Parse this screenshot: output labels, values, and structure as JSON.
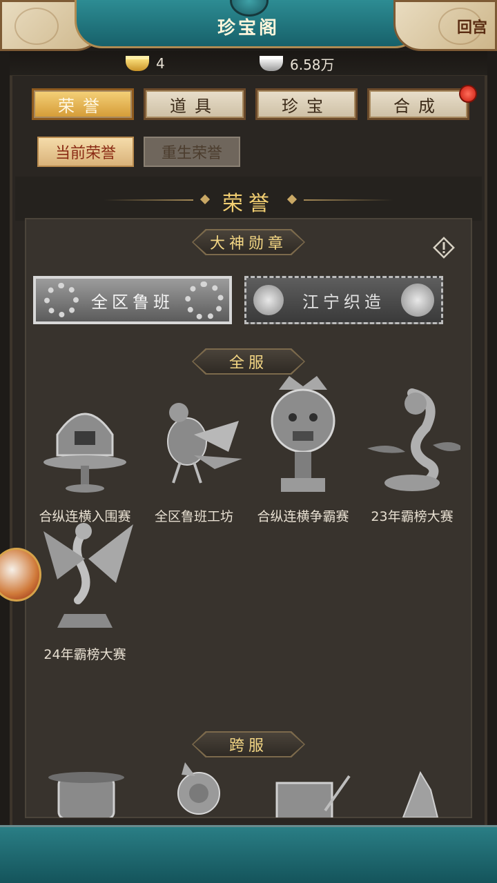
{
  "header": {
    "title": "珍宝阁",
    "back_label": "回宫"
  },
  "currency": {
    "gold": "4",
    "silver": "6.58万"
  },
  "tabs": [
    {
      "label": "荣誉",
      "active": true
    },
    {
      "label": "道具",
      "active": false
    },
    {
      "label": "珍宝",
      "active": false
    },
    {
      "label": "合成",
      "active": false,
      "badge": true
    }
  ],
  "subtabs": [
    {
      "label": "当前荣誉",
      "active": true
    },
    {
      "label": "重生荣誉",
      "active": false
    }
  ],
  "section_title": "荣誉",
  "medals": {
    "ribbon": "大神勋章",
    "items": [
      {
        "label": "全区鲁班"
      },
      {
        "label": "江宁织造"
      }
    ]
  },
  "all_server": {
    "ribbon": "全服",
    "items": [
      {
        "label": "合纵连横入围赛",
        "icon": "palace-shield-icon"
      },
      {
        "label": "全区鲁班工坊",
        "icon": "mechanical-bird-icon"
      },
      {
        "label": "合纵连横争霸赛",
        "icon": "lion-statue-icon"
      },
      {
        "label": "23年霸榜大赛",
        "icon": "dragon-statue-icon"
      },
      {
        "label": "24年霸榜大赛",
        "icon": "phoenix-statue-icon"
      }
    ]
  },
  "cross_server": {
    "ribbon": "跨服",
    "items": [
      {
        "icon": "cauldron-icon"
      },
      {
        "icon": "rose-icon"
      },
      {
        "icon": "scroll-brush-icon"
      },
      {
        "icon": "mountain-icon"
      }
    ]
  },
  "colors": {
    "gold_text": "#f2cf72",
    "teal": "#2d8c93",
    "badge_red": "#d8291b"
  }
}
